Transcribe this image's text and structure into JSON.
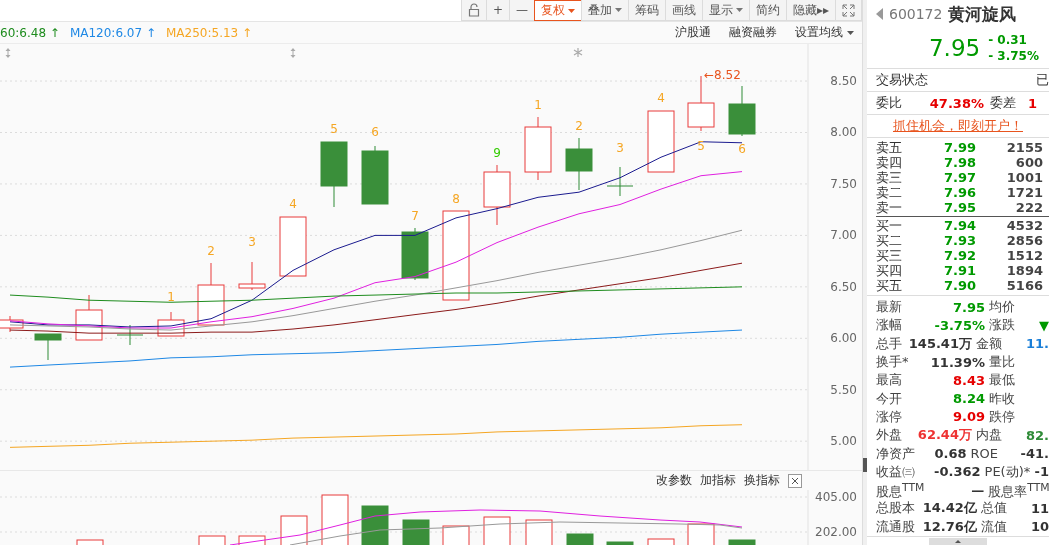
{
  "toolbar": {
    "buttons": [
      {
        "label": "+",
        "dropdown": false,
        "selected": false
      },
      {
        "label": "—",
        "dropdown": false,
        "selected": false
      },
      {
        "label": "复权",
        "dropdown": true,
        "selected": true
      },
      {
        "label": "叠加",
        "dropdown": true,
        "selected": false
      },
      {
        "label": "筹码",
        "dropdown": false,
        "selected": false
      },
      {
        "label": "画线",
        "dropdown": false,
        "selected": false
      },
      {
        "label": "显示",
        "dropdown": true,
        "selected": false
      },
      {
        "label": "简约",
        "dropdown": false,
        "selected": false
      },
      {
        "label": "隐藏▸▸",
        "dropdown": false,
        "selected": false
      }
    ]
  },
  "legend": [
    {
      "text": "60:6.48 ↑",
      "color": "#1e8c1e"
    },
    {
      "text": "MA120:6.07 ↑",
      "color": "#1e88e5"
    },
    {
      "text": "MA250:5.13 ↑",
      "color": "#f5a623"
    }
  ],
  "legend_links": [
    {
      "label": "沪股通",
      "dropdown": false
    },
    {
      "label": "融资融券",
      "dropdown": false
    },
    {
      "label": "设置均线",
      "dropdown": true
    }
  ],
  "chart": {
    "chart_data": {
      "type": "line",
      "ylim": [
        4.72,
        8.86
      ],
      "grid": true,
      "yticks": [
        {
          "value": 8.5,
          "label": "8.50"
        },
        {
          "value": 8,
          "label": "8.00"
        },
        {
          "value": 7.5,
          "label": "7.50"
        },
        {
          "value": 7,
          "label": "7.00"
        },
        {
          "value": 6.5,
          "label": "6.50"
        },
        {
          "value": 6,
          "label": "6.00"
        },
        {
          "value": 5.5,
          "label": "5.50"
        },
        {
          "value": 5,
          "label": "5.00"
        }
      ],
      "series": [
        {
          "color": "#1b1b8f",
          "values": [
            6.16,
            6.13,
            6.13,
            6.11,
            6.12,
            6.19,
            6.37,
            6.66,
            6.86,
            7.0,
            7.0,
            7.17,
            7.26,
            7.37,
            7.42,
            7.56,
            7.76,
            7.91,
            7.9
          ]
        },
        {
          "color": "#e020e0",
          "values": [
            6.17,
            6.14,
            6.12,
            6.1,
            6.1,
            6.16,
            6.21,
            6.29,
            6.39,
            6.54,
            6.6,
            6.74,
            6.93,
            7.08,
            7.21,
            7.3,
            7.45,
            7.58,
            7.62
          ]
        },
        {
          "color": "#999999",
          "values": [
            6.13,
            6.12,
            6.11,
            6.09,
            6.08,
            6.12,
            6.16,
            6.22,
            6.29,
            6.36,
            6.42,
            6.49,
            6.56,
            6.64,
            6.71,
            6.78,
            6.86,
            6.95,
            7.05
          ]
        },
        {
          "color": "#8b1a1a",
          "values": [
            6.08,
            6.07,
            6.05,
            6.05,
            6.05,
            6.06,
            6.06,
            6.09,
            6.13,
            6.18,
            6.23,
            6.28,
            6.34,
            6.41,
            6.47,
            6.53,
            6.59,
            6.66,
            6.73
          ]
        },
        {
          "color": "#1e8c1e",
          "values": [
            6.42,
            6.4,
            6.37,
            6.36,
            6.35,
            6.36,
            6.37,
            6.39,
            6.41,
            6.42,
            6.43,
            6.44,
            6.44,
            6.45,
            6.46,
            6.47,
            6.48,
            6.49,
            6.5
          ]
        },
        {
          "color": "#1e88e5",
          "values": [
            5.72,
            5.74,
            5.76,
            5.78,
            5.81,
            5.82,
            5.84,
            5.85,
            5.86,
            5.88,
            5.9,
            5.92,
            5.94,
            5.97,
            5.99,
            6.01,
            6.04,
            6.06,
            6.08
          ]
        },
        {
          "color": "#f5a623",
          "values": [
            4.94,
            4.95,
            4.96,
            4.98,
            4.99,
            5.0,
            5.01,
            5.03,
            5.04,
            5.05,
            5.06,
            5.07,
            5.09,
            5.1,
            5.11,
            5.12,
            5.13,
            5.15,
            5.16
          ]
        }
      ]
    },
    "candle_marks": [
      {
        "label": "1",
        "color": "#f5a623"
      },
      {
        "label": "2",
        "color": "#f5a623"
      },
      {
        "label": "3",
        "color": "#f5a623"
      },
      {
        "label": "4",
        "color": "#f5a623"
      },
      {
        "label": "5",
        "color": "#f5a623"
      },
      {
        "label": "6",
        "color": "#f5a623"
      },
      {
        "label": "7",
        "color": "#f5a623"
      },
      {
        "label": "8",
        "color": "#f5a623"
      },
      {
        "label": "9",
        "color": "#33cc00"
      },
      {
        "label": "1",
        "color": "#f5a623"
      },
      {
        "label": "2",
        "color": "#f5a623"
      },
      {
        "label": "3",
        "color": "#f5a623"
      },
      {
        "label": "4",
        "color": "#f5a623"
      },
      {
        "label": "5",
        "color": "#f5a623"
      },
      {
        "label": "6",
        "color": "#f5a623"
      }
    ],
    "high_note": "←8.52"
  },
  "indicator_bar": {
    "actions": [
      "改参数",
      "加指标",
      "换指标"
    ]
  },
  "volume": {
    "labels": [
      "405.00",
      "202.00"
    ]
  },
  "quote": {
    "code": "600172",
    "name": "黄河旋风",
    "price": "7.95",
    "change": "- 0.31",
    "change_pct": "- 3.75%"
  },
  "status": {
    "label": "交易状态",
    "value": "已"
  },
  "ratio": {
    "label": "委比",
    "value": "47.38%",
    "label2": "委差",
    "value2": "1"
  },
  "promo": "抓住机会，即刻开户！",
  "asks": [
    {
      "label": "卖五",
      "price": "7.99",
      "volume": "2155"
    },
    {
      "label": "卖四",
      "price": "7.98",
      "volume": "600"
    },
    {
      "label": "卖三",
      "price": "7.97",
      "volume": "1001"
    },
    {
      "label": "卖二",
      "price": "7.96",
      "volume": "1721"
    },
    {
      "label": "卖一",
      "price": "7.95",
      "volume": "222"
    }
  ],
  "bids": [
    {
      "label": "买一",
      "price": "7.94",
      "volume": "4532"
    },
    {
      "label": "买二",
      "price": "7.93",
      "volume": "2856"
    },
    {
      "label": "买三",
      "price": "7.92",
      "volume": "1512"
    },
    {
      "label": "买四",
      "price": "7.91",
      "volume": "1894"
    },
    {
      "label": "买五",
      "price": "7.90",
      "volume": "5166"
    }
  ],
  "stats": [
    {
      "cells": [
        {
          "label": "最新",
          "value": "7.95",
          "color": "#009900"
        },
        {
          "label": "均价"
        }
      ]
    },
    {
      "cells": [
        {
          "label": "涨幅",
          "value": "-3.75%",
          "color": "#009900"
        },
        {
          "label": "涨跌",
          "value": "▼",
          "color": "#009900"
        }
      ]
    },
    {
      "cells": [
        {
          "label": "总手",
          "value": "145.41万",
          "color": "#333333"
        },
        {
          "label": "金额",
          "value": "11.",
          "color": "#1a7fd8"
        }
      ]
    },
    {
      "cells": [
        {
          "label": "换手*",
          "value": "11.39%",
          "color": "#333333"
        },
        {
          "label": "量比"
        }
      ]
    },
    {
      "cells": [
        {
          "label": "最高",
          "value": "8.43",
          "color": "#e60000"
        },
        {
          "label": "最低"
        }
      ]
    },
    {
      "cells": [
        {
          "label": "今开",
          "value": "8.24",
          "color": "#009900"
        },
        {
          "label": "昨收"
        }
      ]
    },
    {
      "cells": [
        {
          "label": "涨停",
          "value": "9.09",
          "color": "#e60000"
        },
        {
          "label": "跌停"
        }
      ]
    },
    {
      "cells": [
        {
          "label": "外盘",
          "value": "62.44万",
          "color": "#ee3333"
        },
        {
          "label": "内盘",
          "value": "82.",
          "color": "#2e8b37"
        }
      ]
    },
    {
      "cells": [
        {
          "label": "净资产",
          "value": "0.68",
          "color": "#333333"
        },
        {
          "label": "ROE",
          "value": "-41.",
          "color": "#333333"
        }
      ]
    },
    {
      "cells": [
        {
          "label": "收益㈢",
          "value": "-0.362",
          "color": "#333333"
        },
        {
          "label": "PE(动)*",
          "value": "-1",
          "color": "#333333"
        }
      ]
    },
    {
      "cells": [
        {
          "label": "股息$^{TTM}$",
          "value": "—",
          "color": "#333333"
        },
        {
          "label": "股息率$^{TTM}$"
        }
      ]
    },
    {
      "cells": [
        {
          "label": "总股本",
          "value": "14.42亿",
          "color": "#333333"
        },
        {
          "label": "总值",
          "value": "11",
          "color": "#333333"
        }
      ]
    },
    {
      "cells": [
        {
          "label": "流通股",
          "value": "12.76亿",
          "color": "#333333"
        },
        {
          "label": "流值",
          "value": "10",
          "color": "#333333"
        }
      ]
    }
  ]
}
